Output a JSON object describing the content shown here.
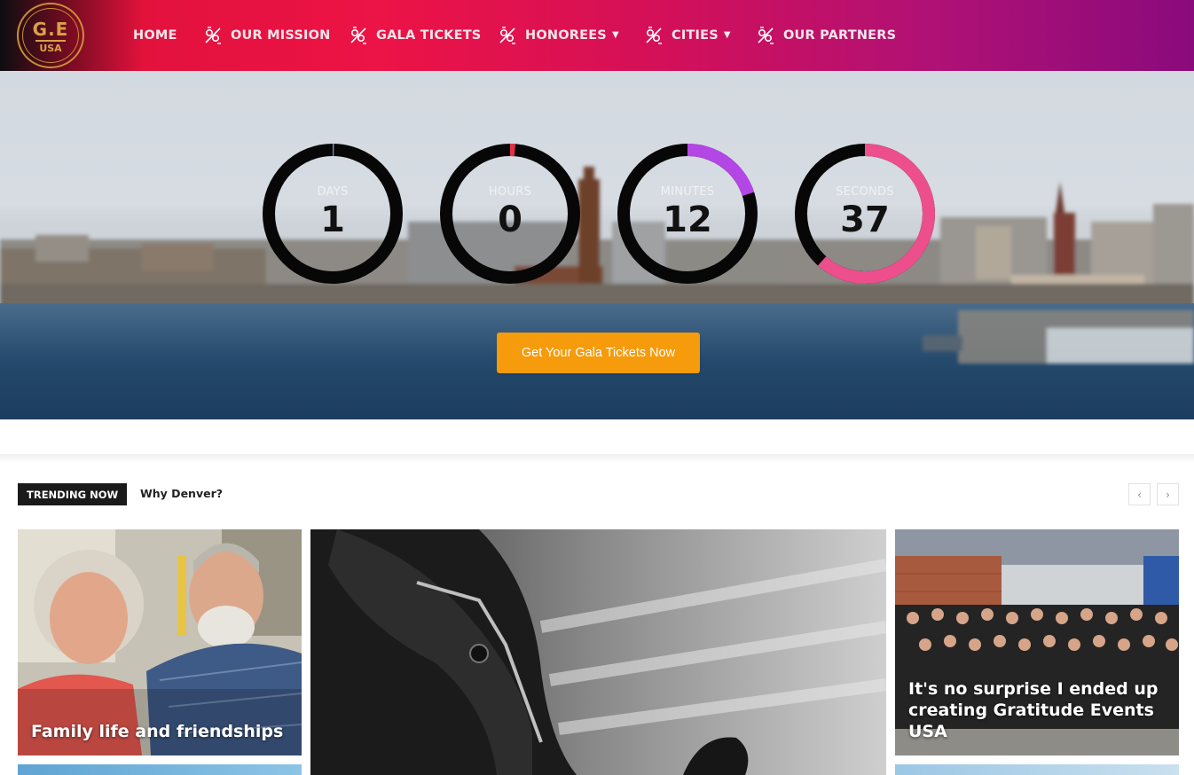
{
  "brand": {
    "logo_mark": "G.E",
    "logo_sub": "USA",
    "gold_color": "#c99035"
  },
  "nav": {
    "items": [
      {
        "label": "HOME",
        "icon": null,
        "has_dropdown": false
      },
      {
        "label": "OUR MISSION",
        "icon": "pins-icon",
        "has_dropdown": false
      },
      {
        "label": "GALA TICKETS",
        "icon": "pins-icon",
        "has_dropdown": false
      },
      {
        "label": "HONOREES",
        "icon": "pins-icon",
        "has_dropdown": true
      },
      {
        "label": "CITIES",
        "icon": "pins-icon",
        "has_dropdown": true
      },
      {
        "label": "OUR PARTNERS",
        "icon": "pins-icon",
        "has_dropdown": false
      }
    ]
  },
  "countdown": [
    {
      "label": "DAYS",
      "value": "1",
      "progress": 0.003,
      "color": "#7b93c4"
    },
    {
      "label": "HOURS",
      "value": "0",
      "progress": 0.012,
      "color": "#e0304a"
    },
    {
      "label": "MINUTES",
      "value": "12",
      "progress": 0.2,
      "color": "#b546e6"
    },
    {
      "label": "SECONDS",
      "value": "37",
      "progress": 0.617,
      "color": "#ec4f8c"
    }
  ],
  "hero": {
    "cta_label": "Get Your Gala Tickets Now",
    "cta_color": "#f59b0c"
  },
  "trending": {
    "tag": "TRENDING NOW",
    "headline": "Why Denver?",
    "prev_icon": "chevron-left-icon",
    "next_icon": "chevron-right-icon",
    "prev_glyph": "‹",
    "next_glyph": "›"
  },
  "cards": [
    {
      "title": "Family life and friendships"
    },
    {
      "title": ""
    },
    {
      "title": "It's no surprise I ended up creating Gratitude Events USA"
    }
  ]
}
